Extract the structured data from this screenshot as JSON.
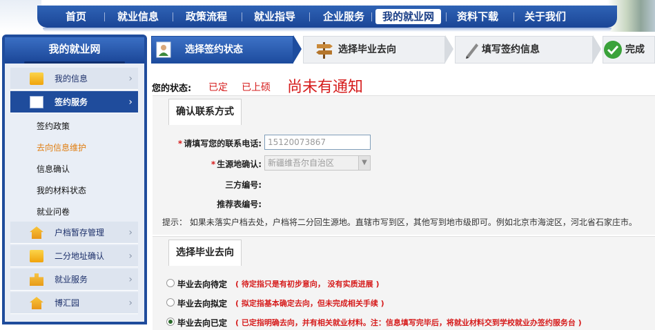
{
  "nav": {
    "items": [
      "首页",
      "就业信息",
      "政策流程",
      "就业指导",
      "企业服务",
      "我的就业网",
      "资料下载",
      "关于我们"
    ],
    "active_index": 5
  },
  "sidebar": {
    "title": "我的就业网",
    "items": [
      {
        "label": "我的信息",
        "icon": "folder-icon"
      },
      {
        "label": "签约服务",
        "icon": "pen-icon",
        "active": true
      },
      {
        "label": "户档暂存管理",
        "icon": "house-icon"
      },
      {
        "label": "二分地址确认",
        "icon": "folder-icon"
      },
      {
        "label": "就业服务",
        "icon": "puzzle-icon"
      },
      {
        "label": "博汇园",
        "icon": "house-icon"
      }
    ],
    "subitems": [
      "签约政策",
      "去向信息维护",
      "信息确认",
      "我的材料状态",
      "就业问卷"
    ],
    "highlight_sub_index": 1
  },
  "steps": [
    {
      "label": "选择签约状态",
      "icon": "person-icon",
      "active": true
    },
    {
      "label": "选择毕业去向",
      "icon": "signpost-icon"
    },
    {
      "label": "填写签约信息",
      "icon": "pen-icon"
    },
    {
      "label": "完成",
      "icon": "check-icon"
    }
  ],
  "status": {
    "label": "您的状态:",
    "values": [
      "已定",
      "已上硕",
      "尚未有通知"
    ]
  },
  "contact": {
    "legend": "确认联系方式",
    "phone_label": "请填写您的联系电话:",
    "phone_value": "15120073867",
    "origin_label": "生源地确认:",
    "origin_value": "新疆维吾尔自治区",
    "third_label": "三方编号:",
    "recommend_label": "推荐表编号:",
    "tip": "提示： 如果未落实户档去处，户档将二分回生源地。直辖市写到区，其他写到地市级即可。例如北京市海淀区，河北省石家庄市。"
  },
  "destination": {
    "legend": "选择毕业去向",
    "options": [
      {
        "label": "毕业去向待定",
        "desc": "( 待定指只是有初步意向， 没有实质进展 )",
        "checked": false
      },
      {
        "label": "毕业去向拟定",
        "desc": "( 拟定指基本确定去向，但未完成相关手续 )",
        "checked": false
      },
      {
        "label": "毕业去向已定",
        "desc": "( 已定指明确去向，并有相关就业材料。注：信息填写完毕后，将就业材料交到学校就业办签约服务台 )",
        "checked": true
      }
    ]
  },
  "colors": {
    "nav_blue": "#1a4596",
    "red": "#d61c1c",
    "orange": "#e07d10"
  }
}
